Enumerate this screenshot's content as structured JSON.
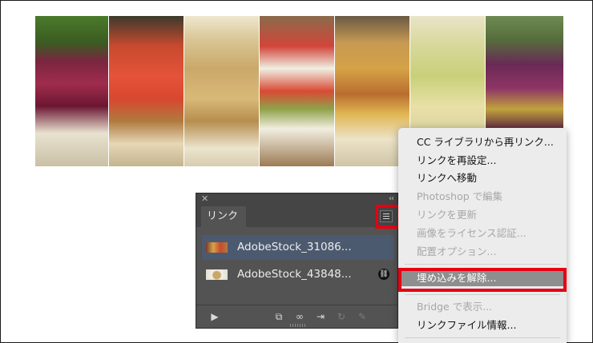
{
  "panel": {
    "tab_label": "リンク",
    "links": [
      {
        "name": "AdobeStock_31086...",
        "selected": true
      },
      {
        "name": "AdobeStock_43848...",
        "selected": false
      }
    ]
  },
  "menu": {
    "items": [
      {
        "label": "CC ライブラリから再リンク...",
        "enabled": true
      },
      {
        "label": "リンクを再設定...",
        "enabled": true
      },
      {
        "label": "リンクへ移動",
        "enabled": true
      },
      {
        "label": "Photoshop で編集",
        "enabled": false
      },
      {
        "label": "リンクを更新",
        "enabled": false
      },
      {
        "label": "画像をライセンス認証...",
        "enabled": false
      },
      {
        "label": "配置オプション...",
        "enabled": false
      },
      {
        "label": "埋め込みを解除...",
        "enabled": true,
        "highlighted": true
      },
      {
        "label": "Bridge で表示...",
        "enabled": false
      },
      {
        "label": "リンクファイル情報...",
        "enabled": true
      }
    ]
  },
  "colors": {
    "highlight_red": "#e60012",
    "panel_bg": "#535353",
    "selected_row": "#4c5a70"
  }
}
